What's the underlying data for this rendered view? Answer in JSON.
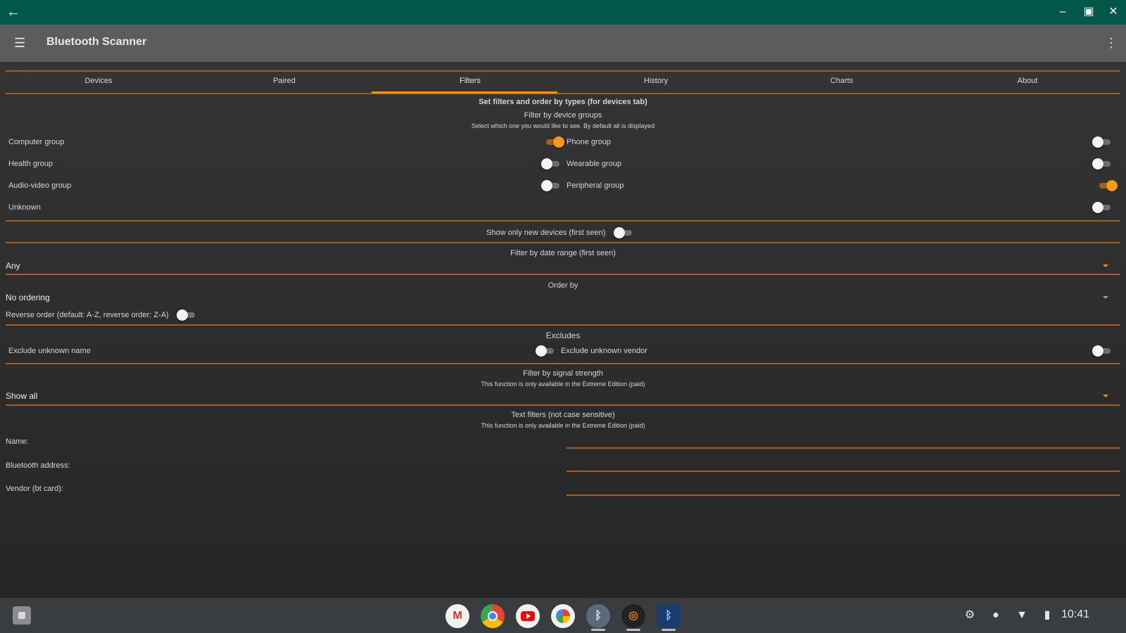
{
  "window": {
    "back_icon": "arrow-left-icon",
    "controls": [
      "minimize-icon",
      "maximize-icon",
      "close-icon"
    ]
  },
  "appbar": {
    "title": "Bluetooth Scanner",
    "menu_icon": "hamburger-icon",
    "more_icon": "more-vert-icon"
  },
  "tabs": [
    {
      "label": "Devices"
    },
    {
      "label": "Paired"
    },
    {
      "label": "Filters",
      "active": true
    },
    {
      "label": "History"
    },
    {
      "label": "Charts"
    },
    {
      "label": "About"
    }
  ],
  "header": {
    "title": "Set filters and order by types (for devices tab)",
    "groups_title": "Filter by device groups",
    "groups_subtitle": "Select which one you would like to see. By default all is displayed"
  },
  "groups": {
    "computer": {
      "label": "Computer group",
      "on": true
    },
    "phone": {
      "label": "Phone group",
      "on": false
    },
    "health": {
      "label": "Health group",
      "on": false
    },
    "wearable": {
      "label": "Wearable group",
      "on": false
    },
    "audio_video": {
      "label": "Audio-video group",
      "on": false
    },
    "peripheral": {
      "label": "Peripheral group",
      "on": true
    },
    "unknown": {
      "label": "Unknown",
      "on": false
    }
  },
  "new_devices": {
    "label": "Show only new devices (first seen)",
    "on": false
  },
  "date_range": {
    "title": "Filter by date range (first seen)",
    "value": "Any"
  },
  "order_by": {
    "title": "Order by",
    "value": "No ordering",
    "reverse_label": "Reverse order (default: A-Z, reverse order: Z-A)",
    "reverse_on": false
  },
  "excludes": {
    "title": "Excludes",
    "unknown_name": "Exclude unknown name",
    "unknown_name_on": false,
    "unknown_vendor": "Exclude unknown vendor",
    "unknown_vendor_on": false
  },
  "signal": {
    "title": "Filter by signal strength",
    "note": "This function is only available in the Extreme Edition (paid)",
    "value": "Show all"
  },
  "text_filters": {
    "title": "Text filters (not case sensitive)",
    "note": "This function is only available in the Extreme Edition (paid)",
    "name_label": "Name:",
    "address_label": "Bluetooth address:",
    "vendor_label": "Vendor (bt card):"
  },
  "colors": {
    "accent": "#f09018",
    "titlebar": "#01574a",
    "appbar": "#5c5c5c",
    "divider": "#a4601b"
  },
  "shelf": {
    "apps": [
      "gmail-icon",
      "chrome-icon",
      "youtube-icon",
      "photos-icon",
      "bluetooth-scanner-icon",
      "game-icon",
      "app-icon"
    ],
    "tray": [
      "settings-icon",
      "notification-icon",
      "wifi-icon",
      "battery-icon"
    ],
    "time": "10:41"
  }
}
